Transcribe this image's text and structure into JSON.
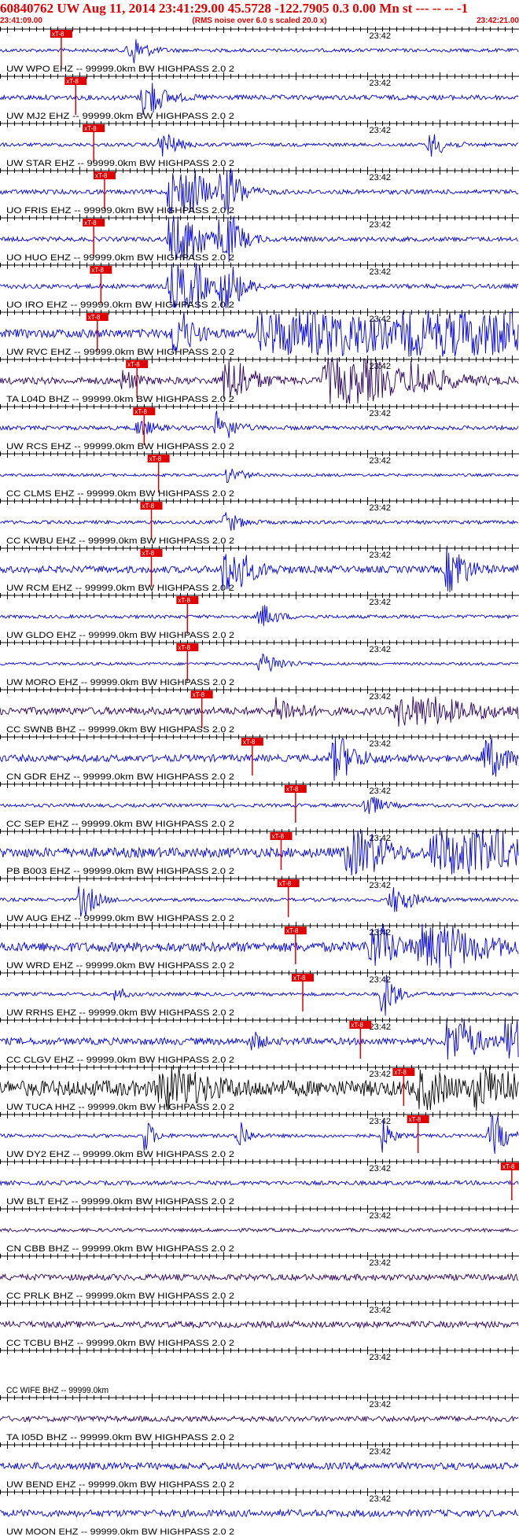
{
  "header": {
    "title": "60840762 UW Aug 11, 2014 23:41:29.00   45.5728 -122.7905  0.3 0.00 Mn st --- -- --  -1",
    "start_time": "23:41:09.00",
    "rms_note": "(RMS noise over 6.0 s scaled 20.0 x)",
    "end_time": "23:42:21.00"
  },
  "pick_label": "xT-8",
  "minute_label": "23:42",
  "colors": {
    "header_red": "#e00000",
    "grid": "#000000",
    "pick": "#e00000",
    "blue": "#0000e6",
    "purple": "#2a0060",
    "black": "#000000"
  },
  "chart_data": {
    "type": "seismogram",
    "time_window": [
      "23:41:09.00",
      "23:42:21.00"
    ],
    "minute_mark": "23:42",
    "traces": [
      {
        "label": "UW WPO EHZ -- 99999.0km BW  HIGHPASS  2.0  2",
        "color": "blue",
        "pick_s": 17.5,
        "events": [
          [
            17.8,
            0.8,
            2
          ]
        ],
        "noise": 0.1
      },
      {
        "label": "UW MJ2 EHZ -- 99999.0km BW  HIGHPASS  2.0  2",
        "color": "blue",
        "pick_s": 19.5,
        "events": [
          [
            19.8,
            1.0,
            2.5
          ]
        ],
        "noise": 0.14
      },
      {
        "label": "UW STAR EHZ -- 99999.0km BW  HIGHPASS  2.0  2",
        "color": "blue",
        "pick_s": 22.0,
        "events": [
          [
            22.2,
            0.7,
            2
          ],
          [
            59.5,
            0.6,
            2
          ]
        ],
        "noise": 0.1
      },
      {
        "label": "UO FRIS EHZ -- 99999.0km BW  HIGHPASS  2.0  2",
        "color": "blue",
        "pick_s": 23.5,
        "events": [
          [
            23.5,
            2.2,
            2.5
          ],
          [
            25.5,
            2.2,
            1.5
          ],
          [
            30.5,
            2.2,
            2
          ]
        ],
        "noise": 0.13
      },
      {
        "label": "UO HUO EHZ -- 99999.0km BW  HIGHPASS  2.0  2",
        "color": "blue",
        "pick_s": 22.0,
        "events": [
          [
            23.5,
            2.2,
            2.5
          ],
          [
            25.5,
            2.2,
            1.5
          ],
          [
            30.5,
            2.2,
            2
          ]
        ],
        "noise": 0.13
      },
      {
        "label": "UO IRO EHZ -- 99999.0km BW  HIGHPASS  2.0  2",
        "color": "blue",
        "pick_s": 23.0,
        "events": [
          [
            23.5,
            2.2,
            2.5
          ],
          [
            25.5,
            2.2,
            1.5
          ],
          [
            30.5,
            2.2,
            2
          ]
        ],
        "noise": 0.13
      },
      {
        "label": "UW RVC EHZ -- 99999.0km BW  HIGHPASS  2.0  2",
        "color": "blue",
        "pick_s": 22.5,
        "events": [
          [
            24,
            1.6,
            2
          ],
          [
            36,
            2.2,
            14
          ],
          [
            56,
            2.4,
            16
          ],
          [
            72,
            1.0,
            5
          ]
        ],
        "noise": 0.25
      },
      {
        "label": "TA L04D BHZ -- 99999.0km BW  HIGHPASS  2.0  2",
        "color": "purple",
        "pick_s": 28.0,
        "events": [
          [
            17,
            0.5,
            1.5
          ],
          [
            31,
            1.6,
            3
          ],
          [
            45,
            1.9,
            8
          ],
          [
            57,
            0.6,
            4
          ]
        ],
        "noise": 0.2
      },
      {
        "label": "UW RCS EHZ -- 99999.0km BW  HIGHPASS  2.0  2",
        "color": "blue",
        "pick_s": 29.0,
        "events": [
          [
            30,
            0.9,
            2
          ],
          [
            19,
            0.4,
            2
          ]
        ],
        "noise": 0.12
      },
      {
        "label": "CC CLMS EHZ -- 99999.0km BW  HIGHPASS  2.0  2",
        "color": "blue",
        "pick_s": 31.0,
        "events": [
          [
            31.5,
            0.4,
            2
          ]
        ],
        "noise": 0.08
      },
      {
        "label": "CC KWBU EHZ -- 99999.0km BW  HIGHPASS  2.0  2",
        "color": "blue",
        "pick_s": 30.0,
        "events": [
          [
            31,
            0.5,
            2
          ],
          [
            80,
            0.4,
            6
          ]
        ],
        "noise": 0.1
      },
      {
        "label": "UW RCM EHZ -- 99999.0km BW  HIGHPASS  2.0  2",
        "color": "blue",
        "pick_s": 30.0,
        "events": [
          [
            31,
            1.5,
            3
          ],
          [
            62,
            1.7,
            2
          ],
          [
            72,
            0.5,
            8
          ]
        ],
        "noise": 0.2
      },
      {
        "label": "UW GLDO EHZ -- 99999.0km BW  HIGHPASS  2.0  2",
        "color": "blue",
        "pick_s": 35.0,
        "events": [
          [
            36,
            0.6,
            2
          ]
        ],
        "noise": 0.1
      },
      {
        "label": "UW MORO EHZ -- 99999.0km BW  HIGHPASS  2.0  2",
        "color": "blue",
        "pick_s": 35.0,
        "events": [
          [
            36,
            0.5,
            3
          ]
        ],
        "noise": 0.08
      },
      {
        "label": "CC SWNB BHZ -- 99999.0km BW  HIGHPASS  2.0  2",
        "color": "purple",
        "pick_s": 37.0,
        "events": [
          [
            38,
            0.6,
            3
          ],
          [
            55,
            0.7,
            10
          ],
          [
            72,
            0.5,
            6
          ]
        ],
        "noise": 0.22
      },
      {
        "label": "CN GDR EHZ -- 99999.0km BW  HIGHPASS  2.0  2",
        "color": "blue",
        "pick_s": 44.0,
        "events": [
          [
            46,
            1.1,
            3
          ],
          [
            67,
            1.0,
            3
          ]
        ],
        "noise": 0.2
      },
      {
        "label": "CC SEP EHZ -- 99999.0km BW  HIGHPASS  2.0  2",
        "color": "blue",
        "pick_s": 50.0,
        "events": [
          [
            50.5,
            0.6,
            2
          ]
        ],
        "noise": 0.1
      },
      {
        "label": "PB B003 EHZ -- 99999.0km BW  HIGHPASS  2.0  2",
        "color": "blue",
        "pick_s": 48.0,
        "events": [
          [
            48,
            1.8,
            4
          ],
          [
            60,
            2.0,
            10
          ],
          [
            75,
            0.8,
            5
          ]
        ],
        "noise": 0.28
      },
      {
        "label": "UW AUG EHZ -- 99999.0km BW  HIGHPASS  2.0  2",
        "color": "blue",
        "pick_s": 49.0,
        "events": [
          [
            11,
            0.9,
            2
          ],
          [
            54,
            0.7,
            3
          ]
        ],
        "noise": 0.1
      },
      {
        "label": "UW WRD EHZ -- 99999.0km BW  HIGHPASS  2.0  2",
        "color": "blue",
        "pick_s": 50.0,
        "events": [
          [
            51,
            1.6,
            3
          ],
          [
            58,
            1.2,
            8
          ],
          [
            78,
            0.8,
            8
          ]
        ],
        "noise": 0.28
      },
      {
        "label": "UW RRHS EHZ -- 99999.0km BW  HIGHPASS  2.0  2",
        "color": "blue",
        "pick_s": 51.0,
        "events": [
          [
            53,
            1.3,
            1.5
          ],
          [
            16,
            0.4,
            1
          ]
        ],
        "noise": 0.1
      },
      {
        "label": "CC CLGV EHZ -- 99999.0km BW  HIGHPASS  2.0  2",
        "color": "blue",
        "pick_s": 59.0,
        "events": [
          [
            35,
            0.5,
            1
          ],
          [
            62,
            2.0,
            3
          ],
          [
            70,
            2.2,
            6
          ]
        ],
        "noise": 0.2
      },
      {
        "label": "UW TUCA HHZ -- 99999.0km BW  HIGHPASS  2.0  2",
        "color": "black",
        "pick_s": 65.0,
        "events": [
          [
            22,
            0.9,
            6
          ],
          [
            58,
            0.8,
            4
          ],
          [
            66,
            1.6,
            4
          ]
        ],
        "noise": 0.45
      },
      {
        "label": "UW DY2 EHZ -- 99999.0km BW  HIGHPASS  2.0  2",
        "color": "blue",
        "pick_s": 67.0,
        "events": [
          [
            20,
            0.9,
            1
          ],
          [
            33,
            0.9,
            1
          ],
          [
            53,
            0.9,
            1
          ],
          [
            68,
            1.1,
            2
          ]
        ],
        "noise": 0.1
      },
      {
        "label": "UW BLT EHZ -- 99999.0km BW  HIGHPASS  2.0  2",
        "color": "blue",
        "pick_s": 80.0,
        "events": [
          [
            81,
            0.9,
            2
          ]
        ],
        "noise": 0.12
      },
      {
        "label": "CN CBB BHZ -- 99999.0km BW  HIGHPASS  2.0  2",
        "color": "purple",
        "pick_s": 84.0,
        "events": [
          [
            84,
            0.9,
            1.5
          ]
        ],
        "noise": 0.1
      },
      {
        "label": "CC PRLK BHZ -- 99999.0km BW  HIGHPASS  2.0  2",
        "color": "purple",
        "pick_s": null,
        "events": [],
        "noise": 0.18
      },
      {
        "label": "CC TCBU BHZ -- 99999.0km BW  HIGHPASS  2.0  2",
        "color": "purple",
        "pick_s": null,
        "events": [],
        "noise": 0.18
      },
      {
        "label": "CC WIFE BHZ -- 99999.0km",
        "color": "none",
        "pick_s": null,
        "events": [],
        "noise": 0
      },
      {
        "label": "TA I05D BHZ -- 99999.0km BW  HIGHPASS  2.0  2",
        "color": "purple",
        "pick_s": null,
        "events": [],
        "noise": 0.16
      },
      {
        "label": "UW BEND EHZ -- 99999.0km BW  HIGHPASS  2.0  2",
        "color": "blue",
        "pick_s": null,
        "events": [],
        "noise": 0.2
      },
      {
        "label": "UW MOON EHZ -- 99999.0km BW  HIGHPASS  2.0  2",
        "color": "blue",
        "pick_s": null,
        "events": [],
        "noise": 0.2
      }
    ]
  }
}
